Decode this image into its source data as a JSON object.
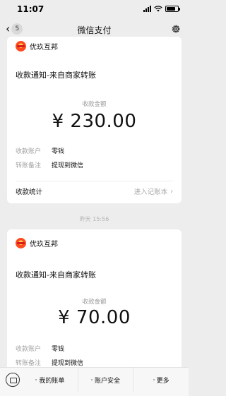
{
  "status_bar": {
    "time": "11:07"
  },
  "nav": {
    "back_count": "5",
    "title": "微信支付"
  },
  "messages": [
    {
      "merchant": "优玖互邦",
      "title": "收款通知-来自商家转账",
      "amount_label": "收款金额",
      "amount": "¥ 230.00",
      "details": [
        {
          "key": "收款账户",
          "value": "零钱"
        },
        {
          "key": "转账备注",
          "value": "提现到微信"
        }
      ],
      "stat_label": "收款统计",
      "stat_link": "进入记账本"
    },
    {
      "timestamp": "昨天 15:56",
      "merchant": "优玖互邦",
      "title": "收款通知-来自商家转账",
      "amount_label": "收款金额",
      "amount": "¥ 70.00",
      "details": [
        {
          "key": "收款账户",
          "value": "零钱"
        },
        {
          "key": "转账备注",
          "value": "提现到微信"
        }
      ]
    }
  ],
  "bottom_menu": {
    "items": [
      {
        "label": "我的账单"
      },
      {
        "label": "账户安全"
      },
      {
        "label": "更多"
      }
    ]
  }
}
